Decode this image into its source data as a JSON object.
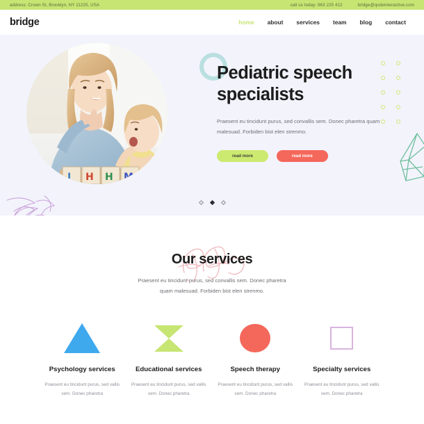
{
  "topbar": {
    "address": "address: Crown St, Brooklyn, NY 11225, USA",
    "phone": "call us today: 963 225 412",
    "email": "bridge@qodeinteractive.com",
    "background_color": "#c6e573"
  },
  "header": {
    "logo": "bridge",
    "nav": [
      {
        "label": "home",
        "active": true
      },
      {
        "label": "about",
        "active": false
      },
      {
        "label": "services",
        "active": false
      },
      {
        "label": "team",
        "active": false
      },
      {
        "label": "blog",
        "active": false
      },
      {
        "label": "contact",
        "active": false
      }
    ],
    "active_color": "#c6e573"
  },
  "hero": {
    "title": "Pediatric speech specialists",
    "paragraph": "Praesent eu tincidunt purus, sed convallis sem. Donec pharetra quam malesuad. Forbiden bist elen strenmo.",
    "buttons": [
      {
        "label": "read more",
        "color": "#ccea6f"
      },
      {
        "label": "read more",
        "color": "#f4675b"
      }
    ],
    "background_color": "#f3f3fc",
    "ring_color": "#b9dfe0",
    "dot_grid_color": "#cde96f",
    "slides": [
      {
        "active": false
      },
      {
        "active": true
      },
      {
        "active": false
      }
    ]
  },
  "services": {
    "title": "Our services",
    "subtitle": "Praesent eu tincidunt purus, sed convallis sem. Donec pharetra quam malesuad. Forbiden bist elen strenmo.",
    "cards": [
      {
        "icon": "triangle-icon",
        "color": "#3fa9ee",
        "title": "Psychology services",
        "text": "Praesent eu tincidunt purus, sed vallis sem. Donec pharetra"
      },
      {
        "icon": "bowtie-icon",
        "color": "#c6e573",
        "title": "Educational services",
        "text": "Praesent eu tincidunt purus, sed vallis sem. Donec pharetra"
      },
      {
        "icon": "circle-icon",
        "color": "#f4675b",
        "title": "Speech therapy",
        "text": "Praesent eu tincidunt purus, sed vallis sem. Donec pharetra"
      },
      {
        "icon": "square-outline-icon",
        "color": "#d8b3dd",
        "title": "Specialty services",
        "text": "Praesent eu tincidunt purus, sed vallis sem. Donec pharetra"
      }
    ]
  }
}
